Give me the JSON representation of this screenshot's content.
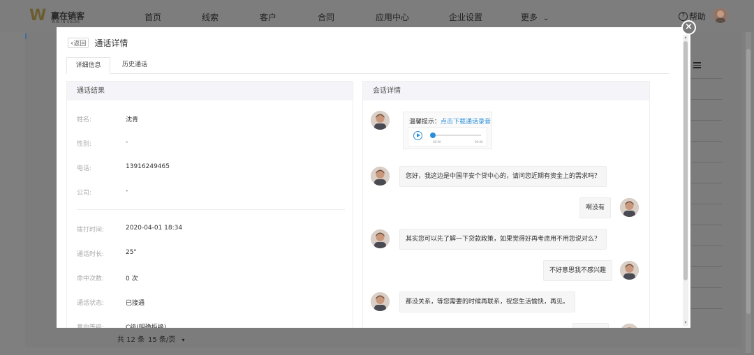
{
  "app": {
    "logo_mark": "W",
    "logo_cn": "赢在销客",
    "logo_en": "WIN IN SALES",
    "nav": [
      "首页",
      "线索",
      "客户",
      "合同",
      "应用中心",
      "企业设置",
      "更多"
    ],
    "nav_more_arrow": "⌄",
    "help_icon": "?",
    "help_label": "帮助",
    "footer_total": "共 12 条",
    "footer_pagesize": "15 条/页",
    "footer_arrow": "▾"
  },
  "modal": {
    "close_symbol": "×",
    "back_label": "返回",
    "back_icon": "‹",
    "title": "通话详情",
    "tabs": [
      {
        "label": "详细信息",
        "active": true
      },
      {
        "label": "历史通话",
        "active": false
      }
    ],
    "result_panel": {
      "title": "通话结果",
      "fields": [
        {
          "label": "姓名:",
          "value": "沈青"
        },
        {
          "label": "性别:",
          "value": "-"
        },
        {
          "label": "电话:",
          "value": "13916249465"
        },
        {
          "label": "公司:",
          "value": "-"
        },
        {
          "label": "拨打时间:",
          "value": "2020-04-01 18:34"
        },
        {
          "label": "通话时长:",
          "value": "25\""
        },
        {
          "label": "命中次数:",
          "value": "0 次"
        },
        {
          "label": "通话状态:",
          "value": "已接通"
        },
        {
          "label": "意向等级:",
          "value": "C级(明确拒绝)"
        }
      ]
    },
    "chat_panel": {
      "title": "会话详情",
      "tip_prefix": "温馨提示：",
      "tip_link": "点击下载通话录音",
      "audio_start": "00:00",
      "audio_end": "00:00",
      "messages": [
        {
          "side": "left",
          "text": "您好，我这边是中国平安个贷中心的，请问您近期有资金上的需求吗？"
        },
        {
          "side": "right",
          "text": "啊没有"
        },
        {
          "side": "left",
          "text": "其实您可以先了解一下贷款政策，如果觉得好再考虑用不用您说对么？"
        },
        {
          "side": "right",
          "text": "不好意思我不感兴趣"
        },
        {
          "side": "left",
          "text": "那没关系，等您需要的时候再联系，祝您生活愉快，再见。"
        }
      ]
    }
  },
  "colors": {
    "accent": "#2a8fd9",
    "panel_header": "#f5f4f9",
    "overlay": "#7f7f7f"
  }
}
